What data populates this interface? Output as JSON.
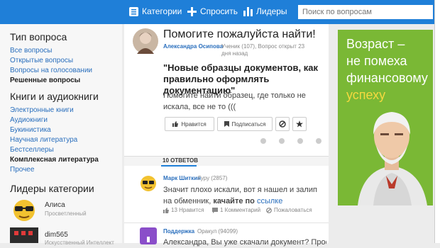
{
  "header": {
    "categories": "Категории",
    "ask": "Спросить",
    "leaders": "Лидеры",
    "search_placeholder": "Поиск по вопросам"
  },
  "sidebar": {
    "question_type_title": "Тип вопроса",
    "question_types": [
      "Все вопросы",
      "Открытые вопросы",
      "Вопросы на голосовании"
    ],
    "question_type_active": "Решенные вопросы",
    "books_title": "Книги и аудиокниги",
    "books": [
      "Электронные книги",
      "Аудиокниги",
      "Букинистика",
      "Научная литература",
      "Бестселлеры"
    ],
    "books_active": "Комплексная литература",
    "books_more": "Прочее",
    "leaders_title": "Лидеры категории",
    "leaders": [
      {
        "name": "Алиса",
        "rank": "Просветленный"
      },
      {
        "name": "dim565",
        "rank": "Искусственный Интеллект"
      }
    ]
  },
  "question": {
    "title": "Помогите пожалуйста найти!",
    "author": "Александра Осипова",
    "meta": "Ученик (107), Вопрос открыт 23 дня назад",
    "bold": "\"Новые образцы документов, как правильно оформлять документацию\"",
    "body": "Помогите найти образец, где только не искала, все не то (((",
    "like": "Нравится",
    "subscribe": "Подписаться"
  },
  "answers": {
    "count_label": "10 ОТВЕТОВ",
    "items": [
      {
        "author": "Марк Шиткин",
        "rank": "Гуру (2857)",
        "text_prefix": "Значит плохо искали, вот я нашел и залип на обменник, ",
        "text_bold": "качайте по ",
        "link": "ссылке",
        "likes": "13 Нравится",
        "comments": "1 Комментарий",
        "complain": "Пожаловаться"
      },
      {
        "author": "Поддержка",
        "rank": "Оракул (94099)",
        "text": "Александра, Вы уже скачали документ? Просто у"
      }
    ]
  },
  "ad": {
    "line1": "Возраст –",
    "line2": "не помеха",
    "line3": "финансовому",
    "accent": "успеху"
  },
  "colors": {
    "brand": "#1f7fd8",
    "ad_bg": "#7ab835",
    "link": "#2a6fbd"
  }
}
